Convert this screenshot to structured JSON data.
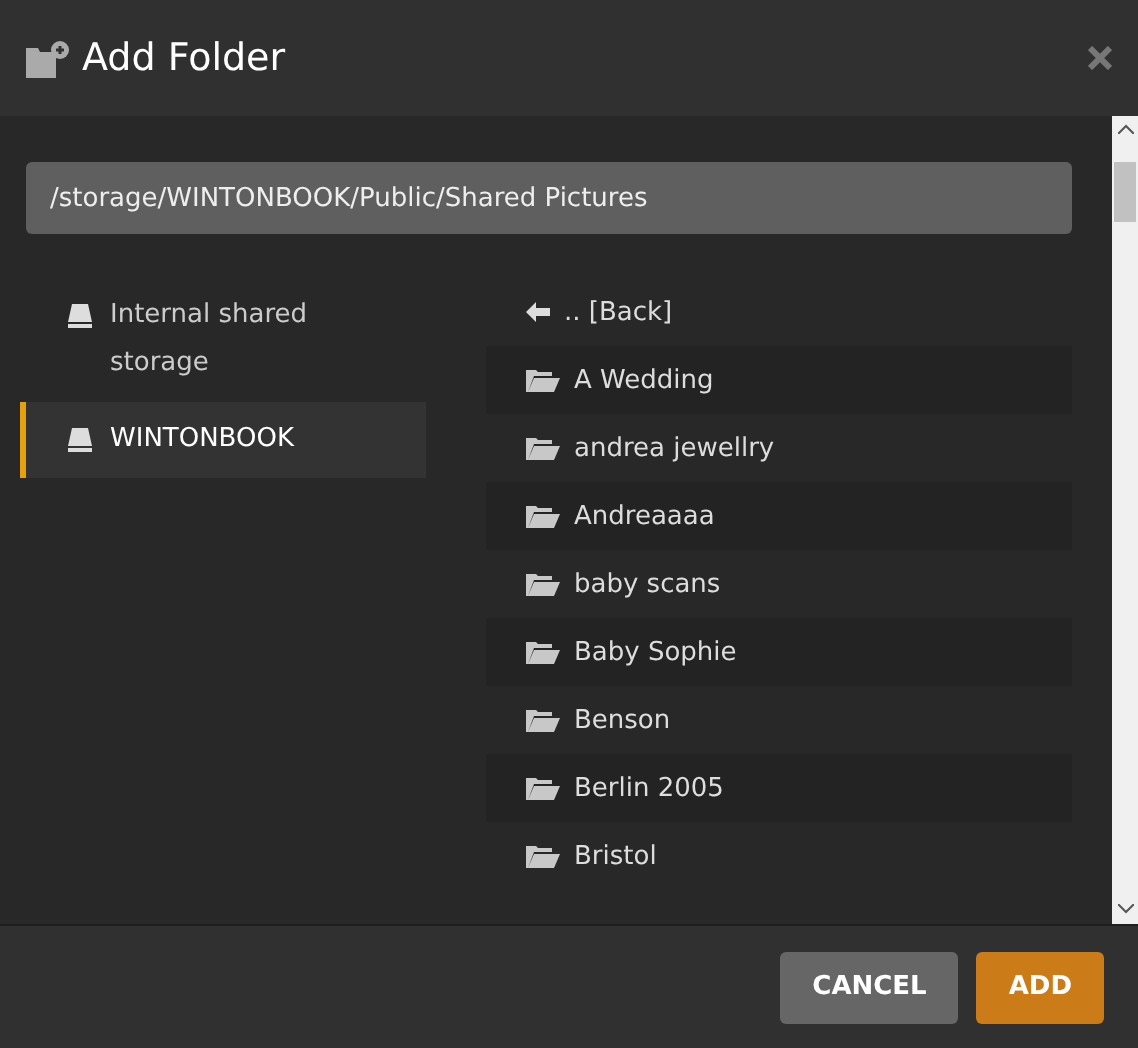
{
  "window": {
    "title": "Add Folder"
  },
  "path_field": {
    "value": "/storage/WINTONBOOK/Public/Shared Pictures"
  },
  "locations": [
    {
      "label": "Internal shared storage",
      "selected": false
    },
    {
      "label": "WINTONBOOK",
      "selected": true
    }
  ],
  "entries": [
    {
      "kind": "back",
      "label": ".. [Back]"
    },
    {
      "kind": "folder",
      "label": "A Wedding"
    },
    {
      "kind": "folder",
      "label": "andrea jewellry"
    },
    {
      "kind": "folder",
      "label": "Andreaaaa"
    },
    {
      "kind": "folder",
      "label": "baby scans"
    },
    {
      "kind": "folder",
      "label": "Baby Sophie"
    },
    {
      "kind": "folder",
      "label": "Benson"
    },
    {
      "kind": "folder",
      "label": "Berlin 2005"
    },
    {
      "kind": "folder",
      "label": "Bristol"
    }
  ],
  "buttons": [
    {
      "kind": "secondary",
      "label": "CANCEL"
    },
    {
      "kind": "primary",
      "label": "ADD"
    }
  ]
}
